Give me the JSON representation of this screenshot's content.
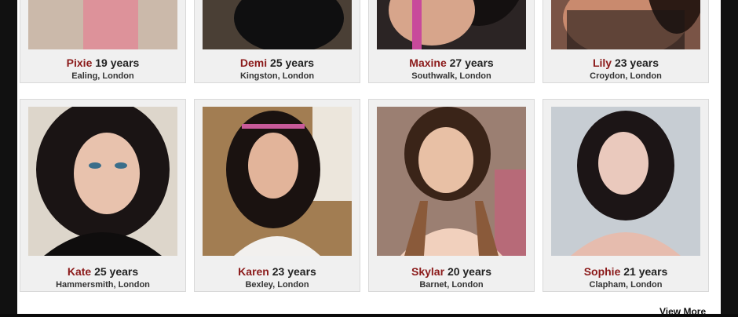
{
  "profiles_row1": [
    {
      "name": "Pixie",
      "age": "19 years",
      "location": "Ealing, London",
      "photo_bg": "#c9b7a8"
    },
    {
      "name": "Demi",
      "age": "25 years",
      "location": "Kingston, London",
      "photo_bg": "#3a3330"
    },
    {
      "name": "Maxine",
      "age": "27 years",
      "location": "Southwalk, London",
      "photo_bg": "#2b2424"
    },
    {
      "name": "Lily",
      "age": "23 years",
      "location": "Croydon, London",
      "photo_bg": "#7a5446"
    }
  ],
  "profiles_row2": [
    {
      "name": "Kate",
      "age": "25 years",
      "location": "Hammersmith, London",
      "photo_bg": "#d8d2c8"
    },
    {
      "name": "Karen",
      "age": "23 years",
      "location": "Bexley, London",
      "photo_bg": "#a27d52"
    },
    {
      "name": "Skylar",
      "age": "20 years",
      "location": "Barnet, London",
      "photo_bg": "#8a6a5a"
    },
    {
      "name": "Sophie",
      "age": "21 years",
      "location": "Clapham, London",
      "photo_bg": "#c7cdd3"
    }
  ],
  "view_more_label": "View More"
}
